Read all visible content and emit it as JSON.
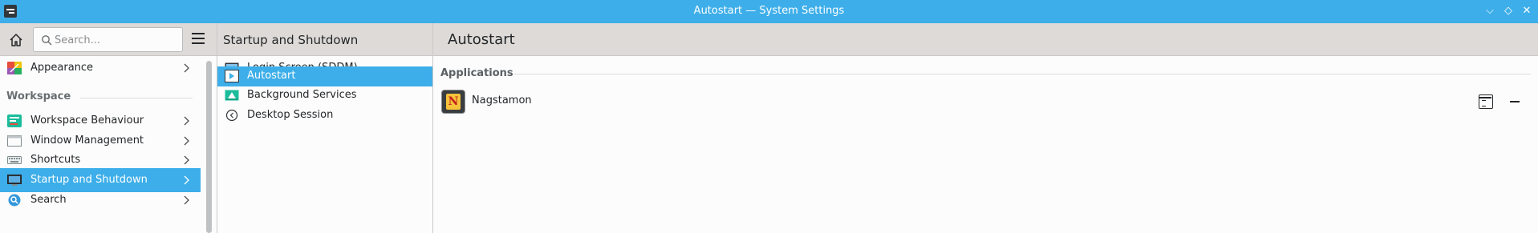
{
  "window": {
    "title": "Autostart — System Settings",
    "controls": {
      "minimize": "⌵",
      "maximize": "◇",
      "close": "✕"
    }
  },
  "sidebar": {
    "search_placeholder": "Search...",
    "items": [
      {
        "label": "Appearance",
        "icon": "appearance-icon",
        "active": false
      },
      {
        "label": "Workspace Behaviour",
        "icon": "workspace-behaviour-icon",
        "active": false
      },
      {
        "label": "Window Management",
        "icon": "window-management-icon",
        "active": false
      },
      {
        "label": "Shortcuts",
        "icon": "keyboard-icon",
        "active": false
      },
      {
        "label": "Startup and Shutdown",
        "icon": "monitor-icon",
        "active": true
      },
      {
        "label": "Search",
        "icon": "search-icon",
        "active": false
      }
    ],
    "section_workspace": "Workspace"
  },
  "middle": {
    "title": "Startup and Shutdown",
    "items": [
      {
        "label": "Login Screen (SDDM)",
        "icon": "login-screen-icon",
        "active": false
      },
      {
        "label": "Autostart",
        "icon": "autostart-icon",
        "active": true
      },
      {
        "label": "Background Services",
        "icon": "background-services-icon",
        "active": false
      },
      {
        "label": "Desktop Session",
        "icon": "desktop-session-icon",
        "active": false
      }
    ]
  },
  "main": {
    "title": "Autostart",
    "group_title": "Applications",
    "apps": [
      {
        "name": "Nagstamon",
        "icon_letter": "N"
      }
    ]
  },
  "colors": {
    "accent": "#3daee9",
    "header_bg": "#dedad7",
    "content_bg": "#fcfcfc"
  }
}
